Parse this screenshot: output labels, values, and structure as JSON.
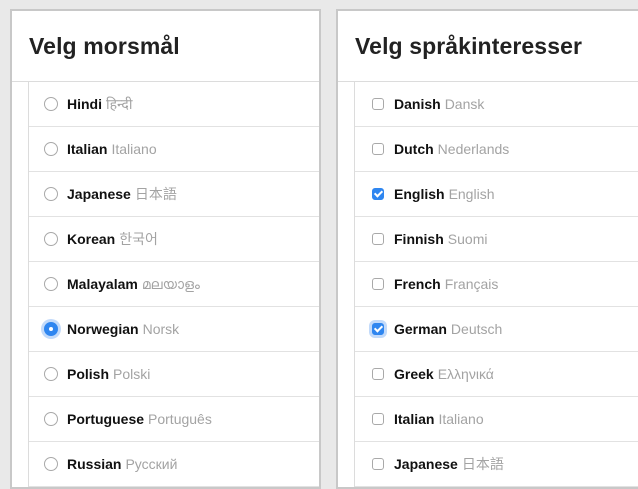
{
  "mother_tongue": {
    "title": "Velg morsmål",
    "items": [
      {
        "name": "Hindi",
        "native": "हिन्दी",
        "selected": false
      },
      {
        "name": "Italian",
        "native": "Italiano",
        "selected": false
      },
      {
        "name": "Japanese",
        "native": "日本語",
        "selected": false
      },
      {
        "name": "Korean",
        "native": "한국어",
        "selected": false
      },
      {
        "name": "Malayalam",
        "native": "മലയാളം",
        "selected": false
      },
      {
        "name": "Norwegian",
        "native": "Norsk",
        "selected": true
      },
      {
        "name": "Polish",
        "native": "Polski",
        "selected": false
      },
      {
        "name": "Portuguese",
        "native": "Português",
        "selected": false
      },
      {
        "name": "Russian",
        "native": "Русский",
        "selected": false
      }
    ]
  },
  "language_interests": {
    "title": "Velg språkinteresser",
    "items": [
      {
        "name": "Danish",
        "native": "Dansk",
        "checked": false
      },
      {
        "name": "Dutch",
        "native": "Nederlands",
        "checked": false
      },
      {
        "name": "English",
        "native": "English",
        "checked": true
      },
      {
        "name": "Finnish",
        "native": "Suomi",
        "checked": false
      },
      {
        "name": "French",
        "native": "Français",
        "checked": false
      },
      {
        "name": "German",
        "native": "Deutsch",
        "checked": true,
        "focused": true
      },
      {
        "name": "Greek",
        "native": "Ελληνικά",
        "checked": false
      },
      {
        "name": "Italian",
        "native": "Italiano",
        "checked": false
      },
      {
        "name": "Japanese",
        "native": "日本語",
        "checked": false
      }
    ]
  },
  "colors": {
    "accent": "#2f86f0",
    "native_text": "#a3a3a3",
    "border": "#dcdcdc"
  }
}
